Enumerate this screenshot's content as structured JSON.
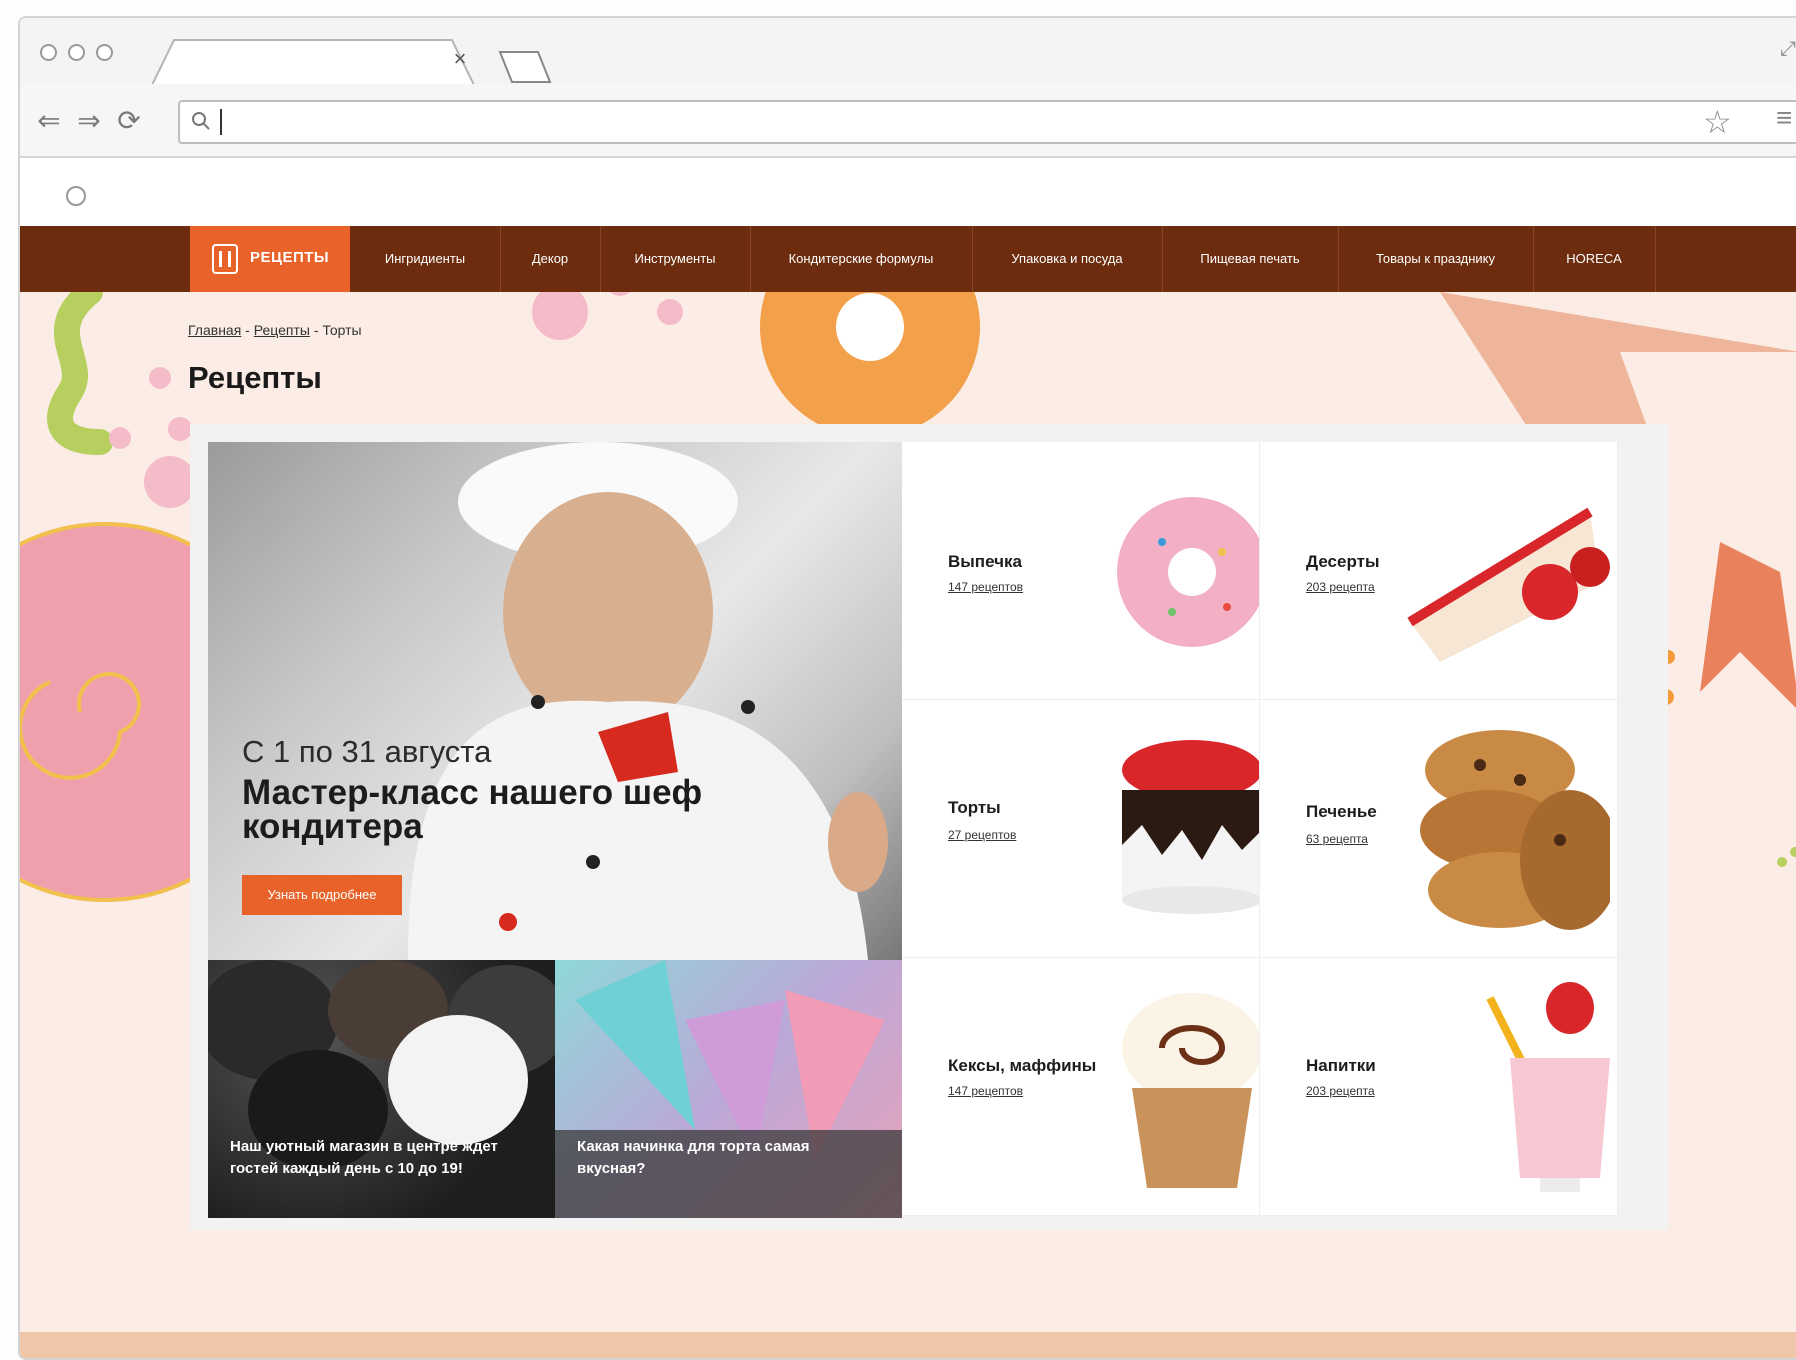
{
  "browser": {
    "tab_close": "×",
    "star_icon": "star-icon",
    "menu_icon": "hamburger-icon"
  },
  "nav": {
    "logo_label": "РЕЦЕПТЫ",
    "items": [
      "Ингридиенты",
      "Декор",
      "Инструменты",
      "Кондитерские формулы",
      "Упаковка и посуда",
      "Пищевая печать",
      "Товары к празднику",
      "HORECA"
    ]
  },
  "breadcrumb": {
    "home": "Главная",
    "sep1": " - ",
    "recipes": "Рецепты",
    "sep2": " - ",
    "current": "Торты"
  },
  "page_title": "Рецепты",
  "hero": {
    "date": "С 1  по 31 августа",
    "title": "Мастер-класс нашего шеф кондитера",
    "button": "Узнать подробнее"
  },
  "tiles": [
    {
      "caption": "Наш уютный магазин в центре ждет гостей каждый день с 10 до 19!"
    },
    {
      "caption": "Какая начинка для торта самая вкусная?"
    }
  ],
  "categories": [
    {
      "name": "Выпечка",
      "count": "147 рецептов"
    },
    {
      "name": "Десерты",
      "count": "203 рецепта"
    },
    {
      "name": "Торты",
      "count": "27 рецептов"
    },
    {
      "name": "Печенье",
      "count": "63 рецепта"
    },
    {
      "name": "Кексы, маффины",
      "count": "147 рецептов"
    },
    {
      "name": "Напитки",
      "count": "203 рецепта"
    }
  ],
  "colors": {
    "nav_bg": "#6e2c0e",
    "accent": "#e9622a",
    "page_bg": "#fbede5"
  }
}
